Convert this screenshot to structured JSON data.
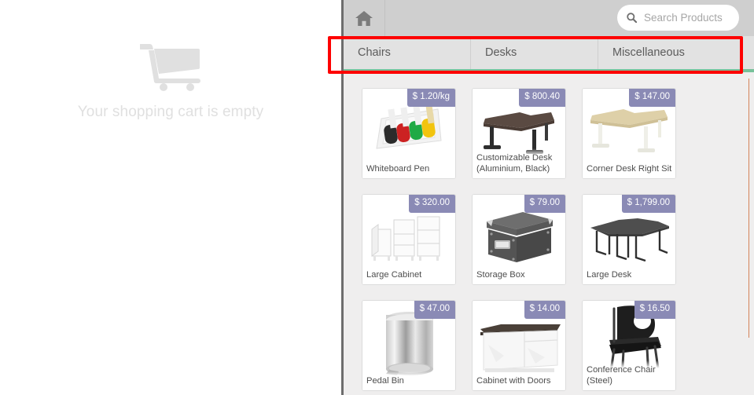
{
  "cart": {
    "icon": "shopping-cart-icon",
    "empty_message": "Your shopping cart is empty"
  },
  "topbar": {
    "home_icon": "home-icon",
    "search": {
      "icon": "search-icon",
      "placeholder": "Search Products",
      "value": ""
    }
  },
  "tabs": [
    {
      "label": "Chairs"
    },
    {
      "label": "Desks"
    },
    {
      "label": "Miscellaneous"
    }
  ],
  "colors": {
    "accent_green": "#77c19a",
    "badge_purple": "#8a8ab5",
    "panel_bg": "#efeeee",
    "topbar_bg": "#cfcfcf",
    "tabstrip_bg": "#e2e2e2",
    "annotation_red": "#fe0000",
    "right_rule": "#d4835a"
  },
  "products": [
    [
      {
        "name": "Whiteboard Pen",
        "price": "$ 1.20/kg",
        "image": "whiteboard-pens-image"
      },
      {
        "name": "Customizable Desk (Aluminium, Black)",
        "price": "$ 800.40",
        "image": "customizable-desk-image"
      },
      {
        "name": "Corner Desk Right Sit",
        "price": "$ 147.00",
        "image": "corner-desk-image"
      }
    ],
    [
      {
        "name": "Large Cabinet",
        "price": "$ 320.00",
        "image": "large-cabinet-image"
      },
      {
        "name": "Storage Box",
        "price": "$ 79.00",
        "image": "storage-box-image"
      },
      {
        "name": "Large Desk",
        "price": "$ 1,799.00",
        "image": "large-desk-image"
      }
    ],
    [
      {
        "name": "Pedal Bin",
        "price": "$ 47.00",
        "image": "pedal-bin-image"
      },
      {
        "name": "Cabinet with Doors",
        "price": "$ 14.00",
        "image": "cabinet-with-doors-image"
      },
      {
        "name": "Conference Chair (Steel)",
        "price": "$ 16.50",
        "image": "conference-chair-image"
      }
    ]
  ]
}
